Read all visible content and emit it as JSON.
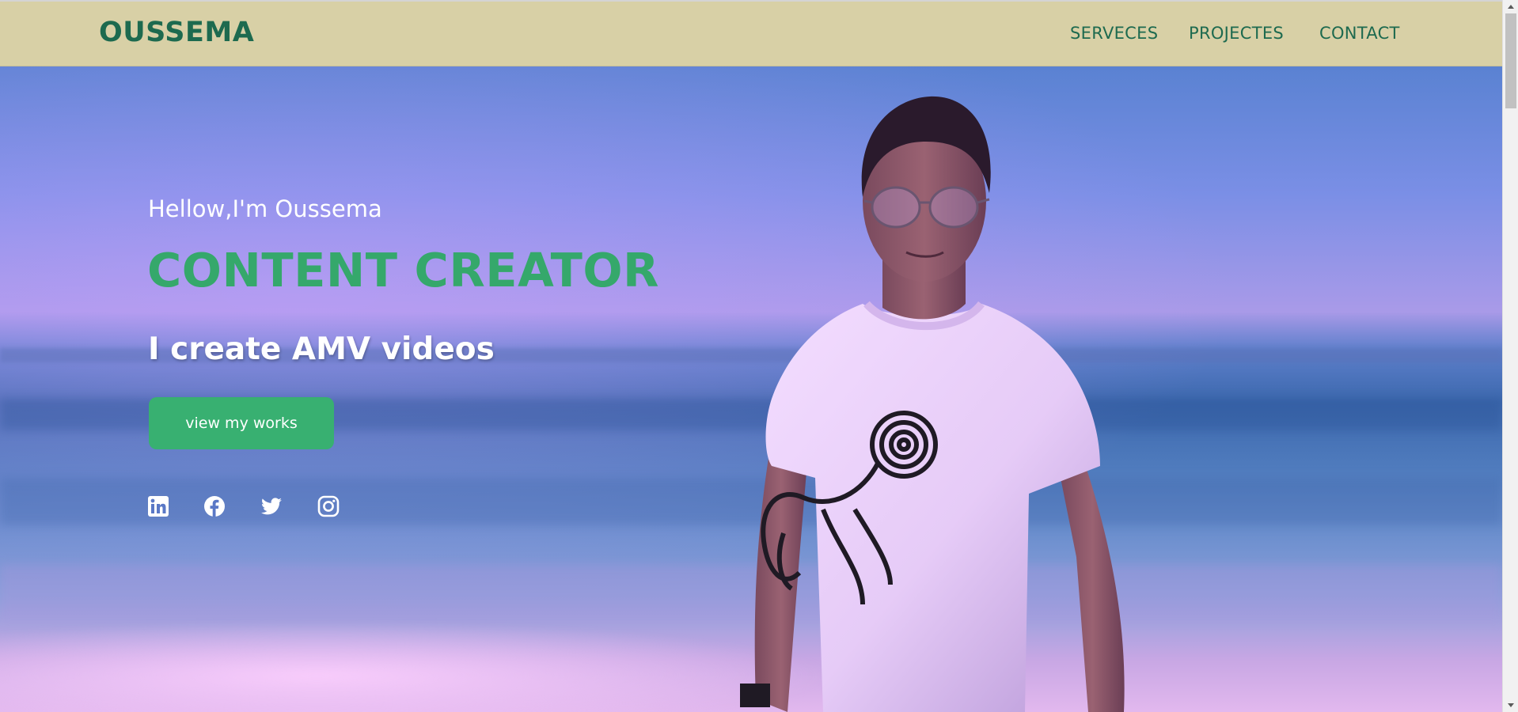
{
  "navbar": {
    "logo": "OUSSEMA",
    "links": [
      {
        "label": "SERVECES"
      },
      {
        "label": "PROJECTES"
      },
      {
        "label": "CONTACT"
      }
    ]
  },
  "hero": {
    "greeting": "Hellow,I'm Oussema",
    "role": "CONTENT CREATOR",
    "tagline": "I create AMV videos",
    "cta_label": "view my works",
    "social": [
      {
        "icon": "linkedin-icon"
      },
      {
        "icon": "facebook-icon"
      },
      {
        "icon": "twitter-icon"
      },
      {
        "icon": "instagram-icon"
      }
    ],
    "background_image": "photo of a young man with glasses in a white t-shirt standing by the sea"
  },
  "colors": {
    "navbar_bg": "#d8d0a6",
    "brand_green_dark": "#1d6a4f",
    "accent_green": "#38b071",
    "text_white": "#ffffff"
  }
}
